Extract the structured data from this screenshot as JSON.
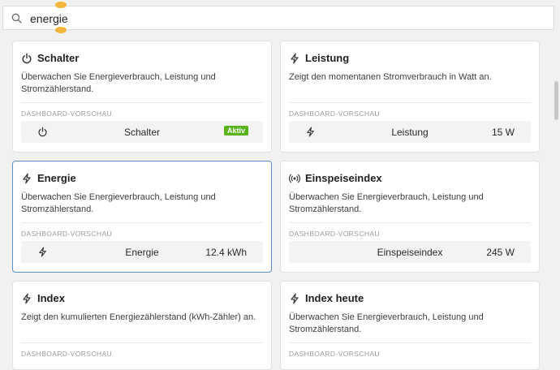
{
  "search": {
    "value": "energie"
  },
  "preview_label": "DASHBOARD-VORSCHAU",
  "cards": [
    {
      "title": "Schalter",
      "icon": "power-icon",
      "description": "Überwachen Sie Energieverbrauch, Leistung und Stromzählerstand.",
      "preview": {
        "icon": "power-icon",
        "name": "Schalter",
        "badge": "Aktiv"
      }
    },
    {
      "title": "Leistung",
      "icon": "bolt-icon",
      "description": "Zeigt den momentanen Stromverbrauch in Watt an.",
      "preview": {
        "icon": "bolt-icon",
        "name": "Leistung",
        "value": "15 W"
      }
    },
    {
      "title": "Energie",
      "icon": "bolt-icon",
      "description": "Überwachen Sie Energieverbrauch, Leistung und Stromzählerstand.",
      "preview": {
        "icon": "bolt-icon",
        "name": "Energie",
        "value": "12.4 kWh"
      }
    },
    {
      "title": "Einspeiseindex",
      "icon": "broadcast-icon",
      "description": "Überwachen Sie Energieverbrauch, Leistung und Stromzählerstand.",
      "preview": {
        "name": "Einspeiseindex",
        "value": "245 W"
      }
    },
    {
      "title": "Index",
      "icon": "bolt-icon",
      "description": "Zeigt den kumulierten Energiezählerstand (kWh-Zähler) an."
    },
    {
      "title": "Index heute",
      "icon": "bolt-icon",
      "description": "Überwachen Sie Energieverbrauch, Leistung und Stromzählerstand."
    }
  ]
}
